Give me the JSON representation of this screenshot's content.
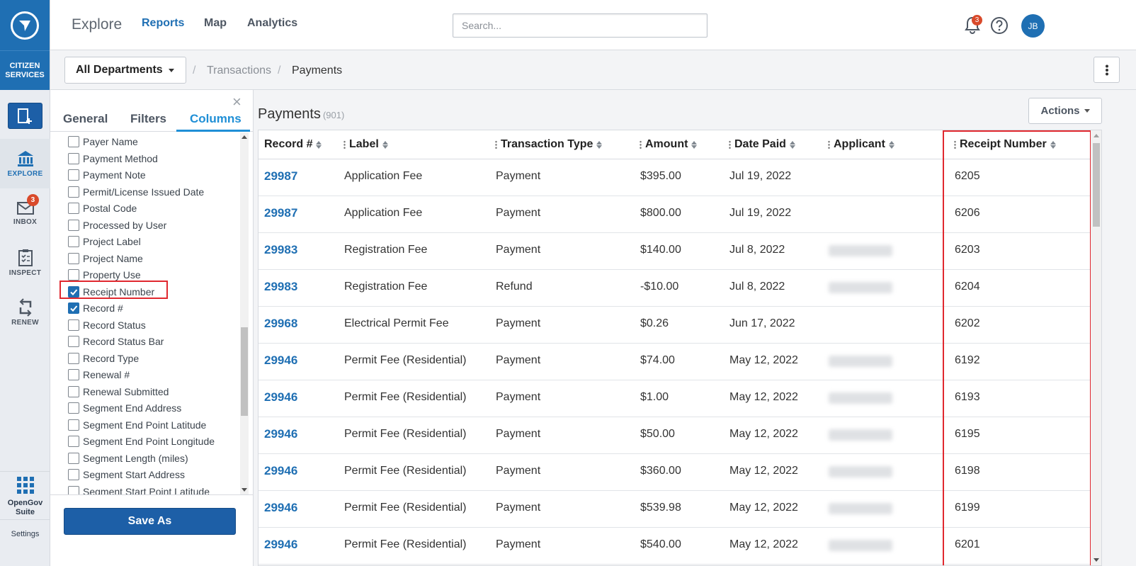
{
  "rail": {
    "brand": "CITIZEN SERVICES",
    "items": [
      {
        "label": "EXPLORE"
      },
      {
        "label": "INBOX",
        "badge": "3"
      },
      {
        "label": "INSPECT"
      },
      {
        "label": "RENEW"
      }
    ],
    "suite": "OpenGov Suite",
    "settings": "Settings"
  },
  "topbar": {
    "explore": "Explore",
    "links": [
      "Reports",
      "Map",
      "Analytics"
    ],
    "search_placeholder": "Search...",
    "notif_count": "3",
    "avatar": "JB"
  },
  "breadcrumb": {
    "department": "All Departments",
    "items": [
      "Transactions",
      "Payments"
    ]
  },
  "panel": {
    "tabs": [
      "General",
      "Filters",
      "Columns"
    ],
    "active_tab": "Columns",
    "columns": [
      {
        "label": "Payer Name",
        "checked": false
      },
      {
        "label": "Payment Method",
        "checked": false
      },
      {
        "label": "Payment Note",
        "checked": false
      },
      {
        "label": "Permit/License Issued Date",
        "checked": false
      },
      {
        "label": "Postal Code",
        "checked": false
      },
      {
        "label": "Processed by User",
        "checked": false
      },
      {
        "label": "Project Label",
        "checked": false
      },
      {
        "label": "Project Name",
        "checked": false
      },
      {
        "label": "Property Use",
        "checked": false
      },
      {
        "label": "Receipt Number",
        "checked": true
      },
      {
        "label": "Record #",
        "checked": true
      },
      {
        "label": "Record Status",
        "checked": false
      },
      {
        "label": "Record Status Bar",
        "checked": false
      },
      {
        "label": "Record Type",
        "checked": false
      },
      {
        "label": "Renewal #",
        "checked": false
      },
      {
        "label": "Renewal Submitted",
        "checked": false
      },
      {
        "label": "Segment End Address",
        "checked": false
      },
      {
        "label": "Segment End Point Latitude",
        "checked": false
      },
      {
        "label": "Segment End Point Longitude",
        "checked": false
      },
      {
        "label": "Segment Length (miles)",
        "checked": false
      },
      {
        "label": "Segment Start Address",
        "checked": false
      },
      {
        "label": "Segment Start Point Latitude",
        "checked": false
      }
    ],
    "save_as": "Save As"
  },
  "main": {
    "title": "Payments",
    "count": "(901)",
    "actions": "Actions",
    "headers": [
      "Record #",
      "Label",
      "Transaction Type",
      "Amount",
      "Date Paid",
      "Applicant",
      "Receipt Number"
    ],
    "rows": [
      {
        "record": "29987",
        "label": "Application Fee",
        "type": "Payment",
        "amount": "$395.00",
        "date": "Jul 19, 2022",
        "applicant_blurred": false,
        "receipt": "6205"
      },
      {
        "record": "29987",
        "label": "Application Fee",
        "type": "Payment",
        "amount": "$800.00",
        "date": "Jul 19, 2022",
        "applicant_blurred": false,
        "receipt": "6206"
      },
      {
        "record": "29983",
        "label": "Registration Fee",
        "type": "Payment",
        "amount": "$140.00",
        "date": "Jul 8, 2022",
        "applicant_blurred": true,
        "receipt": "6203"
      },
      {
        "record": "29983",
        "label": "Registration Fee",
        "type": "Refund",
        "amount": "-$10.00",
        "date": "Jul 8, 2022",
        "applicant_blurred": true,
        "receipt": "6204"
      },
      {
        "record": "29968",
        "label": "Electrical Permit Fee",
        "type": "Payment",
        "amount": "$0.26",
        "date": "Jun 17, 2022",
        "applicant_blurred": false,
        "receipt": "6202"
      },
      {
        "record": "29946",
        "label": "Permit Fee (Residential)",
        "type": "Payment",
        "amount": "$74.00",
        "date": "May 12, 2022",
        "applicant_blurred": true,
        "receipt": "6192"
      },
      {
        "record": "29946",
        "label": "Permit Fee (Residential)",
        "type": "Payment",
        "amount": "$1.00",
        "date": "May 12, 2022",
        "applicant_blurred": true,
        "receipt": "6193"
      },
      {
        "record": "29946",
        "label": "Permit Fee (Residential)",
        "type": "Payment",
        "amount": "$50.00",
        "date": "May 12, 2022",
        "applicant_blurred": true,
        "receipt": "6195"
      },
      {
        "record": "29946",
        "label": "Permit Fee (Residential)",
        "type": "Payment",
        "amount": "$360.00",
        "date": "May 12, 2022",
        "applicant_blurred": true,
        "receipt": "6198"
      },
      {
        "record": "29946",
        "label": "Permit Fee (Residential)",
        "type": "Payment",
        "amount": "$539.98",
        "date": "May 12, 2022",
        "applicant_blurred": true,
        "receipt": "6199"
      },
      {
        "record": "29946",
        "label": "Permit Fee (Residential)",
        "type": "Payment",
        "amount": "$540.00",
        "date": "May 12, 2022",
        "applicant_blurred": true,
        "receipt": "6201"
      }
    ]
  },
  "colors": {
    "brand_blue": "#1f6fb3",
    "link_blue": "#1f6fb3",
    "highlight_red": "#e0282f",
    "badge_red": "#d94a2b"
  }
}
